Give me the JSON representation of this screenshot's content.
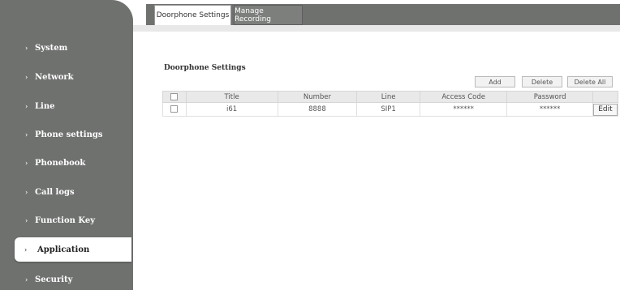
{
  "sidebar": {
    "items": [
      {
        "label": "System"
      },
      {
        "label": "Network"
      },
      {
        "label": "Line"
      },
      {
        "label": "Phone settings"
      },
      {
        "label": "Phonebook"
      },
      {
        "label": "Call logs"
      },
      {
        "label": "Function Key"
      },
      {
        "label": "Application",
        "active": true
      },
      {
        "label": "Security"
      }
    ]
  },
  "tabs": [
    {
      "label": "Doorphone Settings",
      "active": true
    },
    {
      "label": "Manage Recording",
      "active": false
    }
  ],
  "section": {
    "title": "Doorphone Settings"
  },
  "toolbar": {
    "add_label": "Add",
    "delete_label": "Delete",
    "delete_all_label": "Delete All"
  },
  "table": {
    "headers": [
      "Title",
      "Number",
      "Line",
      "Access Code",
      "Password"
    ],
    "rows": [
      {
        "title": "i61",
        "number": "8888",
        "line": "SIP1",
        "access_code": "******",
        "password": "******",
        "edit_label": "Edit"
      }
    ]
  },
  "colors": {
    "sidebar_bg": "#6f716f",
    "header_strip": "#6f716f",
    "table_header_bg": "#e9e9e9"
  }
}
